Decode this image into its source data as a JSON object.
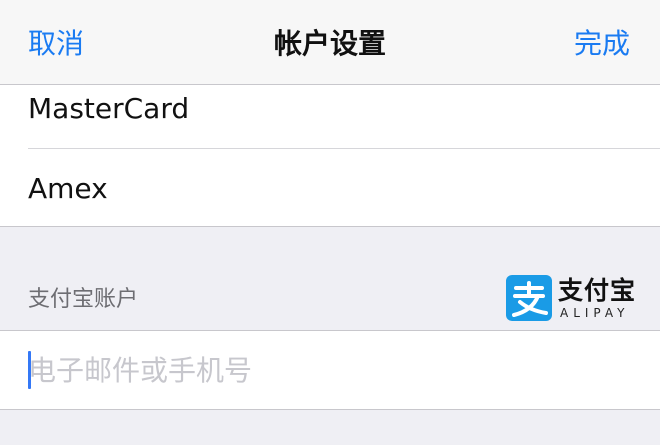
{
  "navbar": {
    "cancel_label": "取消",
    "title": "帐户设置",
    "done_label": "完成"
  },
  "card_list": {
    "items": [
      {
        "label": "MasterCard"
      },
      {
        "label": "Amex"
      }
    ]
  },
  "alipay_section": {
    "header": "支付宝账户",
    "logo": {
      "icon": "alipay-zhi-icon",
      "name_cn": "支付宝",
      "name_en": "ALIPAY"
    },
    "input": {
      "value": "",
      "placeholder": "电子邮件或手机号"
    }
  },
  "colors": {
    "accent": "#1a7bf2",
    "alipay_blue": "#1a9be6",
    "background": "#efeff4"
  }
}
